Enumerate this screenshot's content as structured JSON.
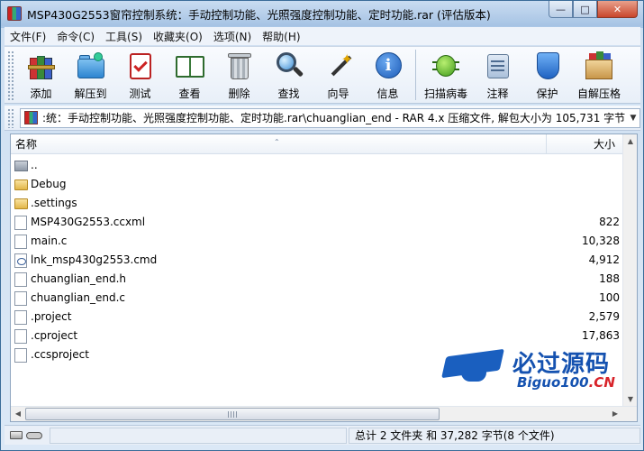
{
  "window": {
    "title": "MSP430G2553窗帘控制系统：手动控制功能、光照强度控制功能、定时功能.rar (评估版本)",
    "controls": [
      "—",
      "□",
      "✕"
    ]
  },
  "menu": [
    "文件(F)",
    "命令(C)",
    "工具(S)",
    "收藏夹(O)",
    "选项(N)",
    "帮助(H)"
  ],
  "toolbar": [
    {
      "label": "添加",
      "icon": "archive-add-icon"
    },
    {
      "label": "解压到",
      "icon": "extract-folder-icon"
    },
    {
      "label": "测试",
      "icon": "test-clipboard-icon"
    },
    {
      "label": "查看",
      "icon": "view-book-icon"
    },
    {
      "label": "删除",
      "icon": "trash-icon"
    },
    {
      "label": "查找",
      "icon": "magnifier-icon"
    },
    {
      "label": "向导",
      "icon": "wizard-wand-icon"
    },
    {
      "label": "信息",
      "icon": "info-icon"
    },
    {
      "label": "扫描病毒",
      "icon": "virus-scan-icon"
    },
    {
      "label": "注释",
      "icon": "comment-icon"
    },
    {
      "label": "保护",
      "icon": "shield-icon"
    },
    {
      "label": "自解压格",
      "icon": "sfx-box-icon"
    }
  ],
  "address": {
    "text": ":统：手动控制功能、光照强度控制功能、定时功能.rar\\chuanglian_end - RAR 4.x 压缩文件, 解包大小为 105,731 字节"
  },
  "columns": {
    "name": "名称",
    "size": "大小"
  },
  "files": [
    {
      "name": "..",
      "size": "",
      "type": "up"
    },
    {
      "name": "Debug",
      "size": "",
      "type": "folder"
    },
    {
      "name": ".settings",
      "size": "",
      "type": "folder"
    },
    {
      "name": "MSP430G2553.ccxml",
      "size": "822",
      "type": "doc"
    },
    {
      "name": "main.c",
      "size": "10,328",
      "type": "doc"
    },
    {
      "name": "lnk_msp430g2553.cmd",
      "size": "4,912",
      "type": "cmd"
    },
    {
      "name": "chuanglian_end.h",
      "size": "188",
      "type": "doc"
    },
    {
      "name": "chuanglian_end.c",
      "size": "100",
      "type": "doc"
    },
    {
      "name": ".project",
      "size": "2,579",
      "type": "doc"
    },
    {
      "name": ".cproject",
      "size": "17,863",
      "type": "doc"
    },
    {
      "name": ".ccsproject",
      "size": "",
      "type": "doc"
    }
  ],
  "watermark": {
    "title": "必过源码",
    "sub_main": "Biguo100",
    "sub_suffix": ".CN"
  },
  "status": {
    "summary": "总计 2 文件夹 和 37,282 字节(8 个文件)"
  }
}
